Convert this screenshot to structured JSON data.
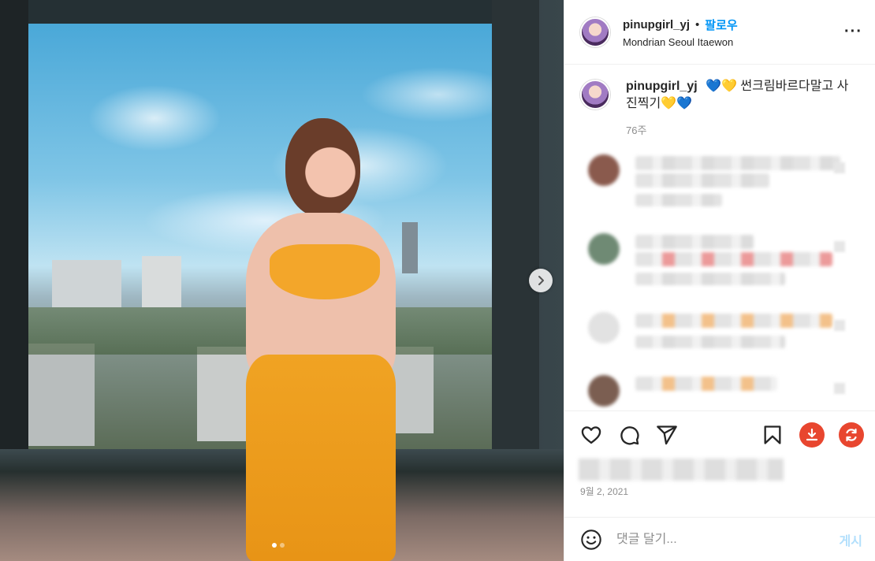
{
  "post": {
    "username": "pinupgirl_yj",
    "separator": "•",
    "follow_label": "팔로우",
    "location": "Mondrian Seoul Itaewon",
    "caption": "💙💛 썬크림바르다말고 사진찍기💛💙",
    "time_ago": "76주",
    "date": "9월 2, 2021"
  },
  "carousel": {
    "current_slide": 1,
    "total_slides": 2
  },
  "composer": {
    "placeholder": "댓글 달기...",
    "post_label": "게시"
  },
  "colors": {
    "link_blue": "#0095f6",
    "post_disabled": "#b2dffc",
    "download_red": "#e8462f",
    "refresh_red": "#e8462f"
  },
  "icons": [
    "heart-icon",
    "comment-icon",
    "share-icon",
    "bookmark-icon",
    "download-icon",
    "refresh-icon",
    "emoji-icon",
    "more-icon",
    "chevron-right-icon"
  ]
}
